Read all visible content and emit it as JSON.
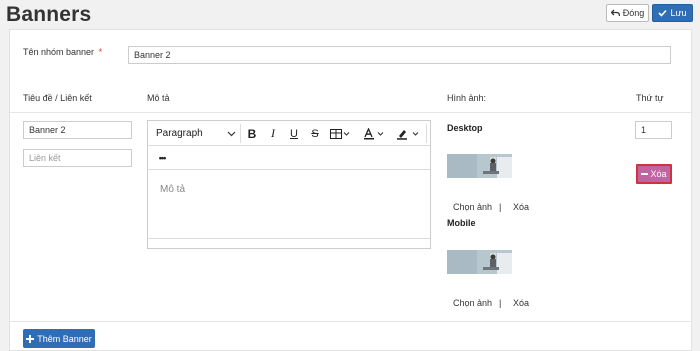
{
  "header": {
    "title": "Banners",
    "close_label": "Đóng",
    "save_label": "Lưu"
  },
  "group": {
    "label": "Tên nhóm banner",
    "required_mark": "*",
    "value": "Banner 2"
  },
  "columns": {
    "title_link": "Tiêu đề / Liên kết",
    "description": "Mô tả",
    "image": "Hình ảnh:",
    "order": "Thứ tự"
  },
  "row": {
    "title_value": "Banner 2",
    "link_placeholder": "Liên kết",
    "editor": {
      "block_format": "Paragraph",
      "more": "•••",
      "placeholder": "Mô tả"
    },
    "desktop_label": "Desktop",
    "mobile_label": "Mobile",
    "choose_image": "Chọn ảnh",
    "divider": "|",
    "delete_image": "Xóa",
    "order_value": "1",
    "delete_row": "Xóa"
  },
  "add_banner": "Thêm Banner",
  "colors": {
    "primary": "#2f6db5",
    "danger_border": "#d0323f",
    "danger_fill": "#c264a0"
  }
}
